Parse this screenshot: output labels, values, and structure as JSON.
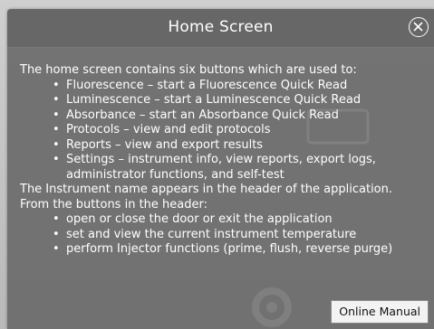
{
  "dialog": {
    "title": "Home Screen",
    "close_icon": "close-circle-icon"
  },
  "content": {
    "intro": "The home screen contains six buttons which are used to:",
    "buttons": [
      "Fluorescence – start a Fluorescence Quick Read",
      "Luminescence – start a Luminescence Quick Read",
      "Absorbance – start an Absorbance Quick Read",
      "Protocols – view and edit protocols",
      "Reports – view and export results",
      "Settings – instrument info, view reports, export logs, administrator functions, and self-test"
    ],
    "instrument_name_note": "The Instrument name appears in the header of the application.",
    "header_intro": "From the buttons in the header:",
    "header_buttons": [
      "open or close the door or exit the application",
      "set and view the current instrument temperature",
      "perform Injector functions (prime, flush, reverse purge)"
    ]
  },
  "footer": {
    "online_manual_label": "Online Manual"
  },
  "colors": {
    "dialog_bg": "#6c6c6c",
    "titlebar_bg": "#676767",
    "text": "#ffffff",
    "button_bg": "#f3f3f3"
  }
}
